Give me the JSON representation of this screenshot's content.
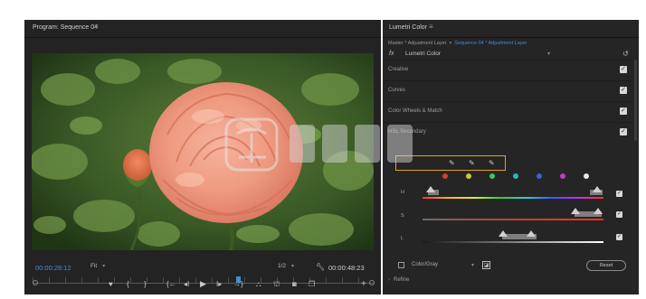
{
  "program": {
    "title": "Program: Sequence 04",
    "menu_icon": "≡",
    "timecode_current": "00:00:28:12",
    "fit_value": "Fit",
    "resolution_value": "1/2",
    "timecode_duration": "00:00:48:23",
    "transport_icons": [
      "marker-icon",
      "in-point-icon",
      "out-point-icon",
      "go-to-in-icon",
      "step-back-icon",
      "play-icon",
      "step-forward-icon",
      "go-to-out-icon",
      "insert-icon",
      "overwrite-icon",
      "export-frame-icon",
      "compare-icon",
      "add-icon"
    ]
  },
  "lumetri": {
    "title": "Lumetri Color",
    "menu_icon": "≡",
    "breadcrumb_master": "Master * Adjustment Layer",
    "breadcrumb_sequence": "Sequence 04 * Adjustment Layer",
    "fx_label": "fx",
    "effect_name": "Lumetri Color",
    "sections": [
      {
        "label": "Creative",
        "checked": true
      },
      {
        "label": "Curves",
        "checked": true
      },
      {
        "label": "Color Wheels & Match",
        "checked": true
      },
      {
        "label": "HSL Secondary",
        "checked": true
      }
    ],
    "swatch_colors": [
      "#d63b3b",
      "#c8c83a",
      "#3bc86a",
      "#2fb8b8",
      "#3b62d6",
      "#c23bc8",
      "#e8e8e8"
    ],
    "hsl_rows": [
      {
        "letter": "H",
        "checked": true
      },
      {
        "letter": "S",
        "checked": true
      },
      {
        "letter": "L",
        "checked": true
      }
    ],
    "color_gray_label": "Color/Gray",
    "reset_label": "Reset",
    "refine_label": "Refine"
  },
  "accent_color": "#3f8fd8",
  "highlight_color": "#e0a030"
}
